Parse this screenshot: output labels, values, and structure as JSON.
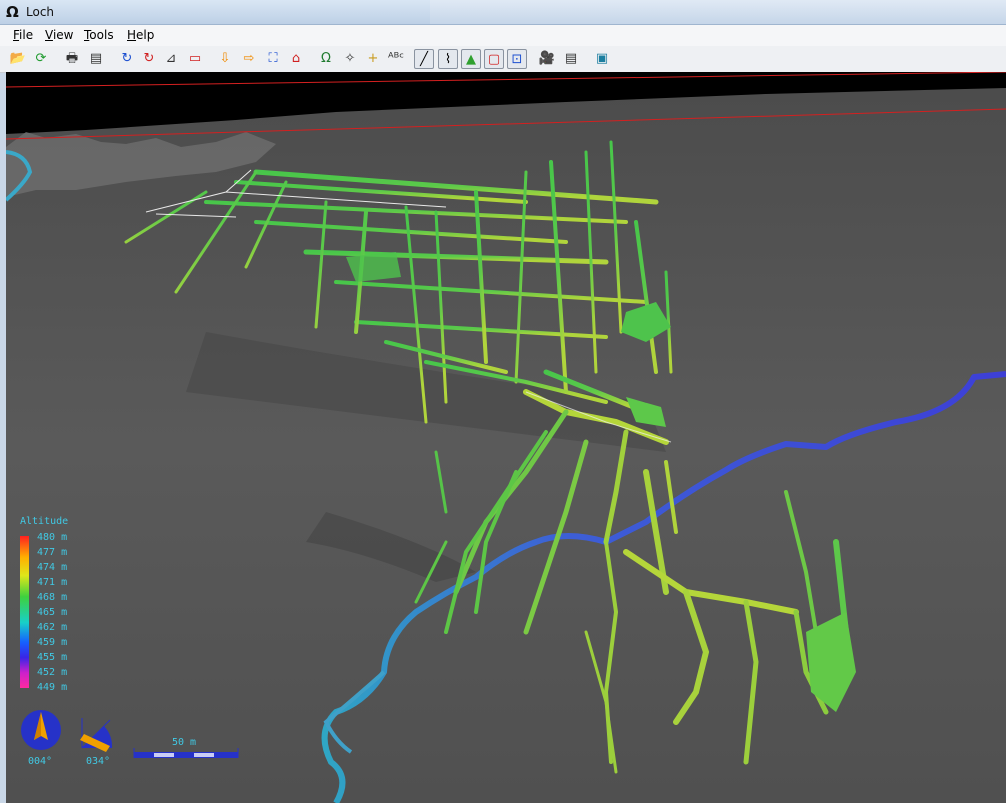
{
  "window": {
    "app_icon": "omega-icon",
    "title": "Loch"
  },
  "menu": [
    {
      "accel": "F",
      "rest": "ile"
    },
    {
      "accel": "V",
      "rest": "iew"
    },
    {
      "accel": "T",
      "rest": "ools"
    },
    {
      "accel": "H",
      "rest": "elp"
    }
  ],
  "toolbar": [
    {
      "icon": "open-folder-icon",
      "glyph": "📂",
      "color": "#c89a1c"
    },
    {
      "icon": "reload-icon",
      "glyph": "⟳",
      "color": "#1f9a2e"
    },
    {
      "icon": "print-icon",
      "glyph": "🖶",
      "color": "#333333"
    },
    {
      "icon": "export-icon",
      "glyph": "▤",
      "color": "#333333"
    },
    {
      "icon": "rotate-icon",
      "glyph": "↻",
      "color": "#1c4fd0"
    },
    {
      "icon": "rotate-stop-icon",
      "glyph": "↻",
      "color": "#d02020"
    },
    {
      "icon": "plan-view-icon",
      "glyph": "⊿",
      "color": "#333333"
    },
    {
      "icon": "stereo-glasses-icon",
      "glyph": "▭",
      "color": "#d02020"
    },
    {
      "icon": "move-down-icon",
      "glyph": "⇩",
      "color": "#f08a00"
    },
    {
      "icon": "move-right-icon",
      "glyph": "⇨",
      "color": "#f08a00"
    },
    {
      "icon": "zoom-all-icon",
      "glyph": "⛶",
      "color": "#1c4fd0"
    },
    {
      "icon": "home-icon",
      "glyph": "⌂",
      "color": "#d02020"
    },
    {
      "icon": "omega-icon",
      "glyph": "Ω",
      "color": "#1f7a2e"
    },
    {
      "icon": "centre-icon",
      "glyph": "✧",
      "color": "#333333"
    },
    {
      "icon": "add-point-icon",
      "glyph": "+",
      "color": "#c89a1c"
    },
    {
      "icon": "labels-icon",
      "glyph": "ᴬᴮᶜ",
      "color": "#333333"
    },
    {
      "icon": "centreline-icon",
      "glyph": "╱",
      "color": "#000000",
      "active": true
    },
    {
      "icon": "walls-icon",
      "glyph": "⌇",
      "color": "#000000",
      "active": true
    },
    {
      "icon": "surface-icon",
      "glyph": "▲",
      "color": "#2fa02f",
      "active": true
    },
    {
      "icon": "bbox-icon",
      "glyph": "▢",
      "color": "#d02020",
      "active": true
    },
    {
      "icon": "scalebar-icon",
      "glyph": "⊡",
      "color": "#1c4fd0",
      "active": true
    },
    {
      "icon": "camera-icon",
      "glyph": "🎥",
      "color": "#333333"
    },
    {
      "icon": "info-icon",
      "glyph": "▤",
      "color": "#333333"
    },
    {
      "icon": "fullscreen-icon",
      "glyph": "▣",
      "color": "#1c7fa0"
    }
  ],
  "legend": {
    "title": "Altitude",
    "labels": [
      "480 m",
      "477 m",
      "474 m",
      "471 m",
      "468 m",
      "465 m",
      "462 m",
      "459 m",
      "455 m",
      "452 m",
      "449 m"
    ]
  },
  "compass": {
    "heading": "004°",
    "tilt": "034°"
  },
  "scalebar": {
    "label": "50 m"
  },
  "colors": {
    "legend_text": "#41c9e4",
    "river": "#3d46d6",
    "cave_green": "#46c84a",
    "cave_yellow": "#a8d23c",
    "terrain": "#565656",
    "bounding_box": "#d42020"
  }
}
